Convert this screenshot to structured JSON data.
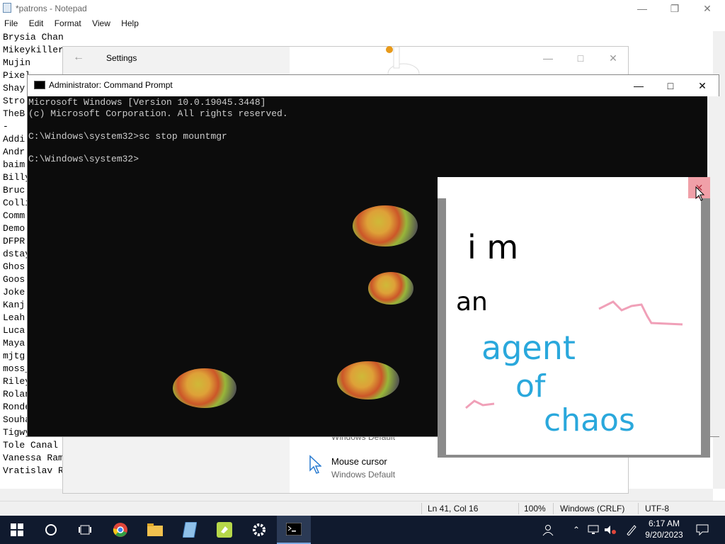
{
  "notepad": {
    "title": "*patrons - Notepad",
    "menu": [
      "File",
      "Edit",
      "Format",
      "View",
      "Help"
    ],
    "lines": [
      "Brysia Chan",
      "Mikeykiller",
      "Mujin",
      "Pixel",
      "Shay",
      "Stro",
      "TheB",
      "-",
      "Addi",
      "Andr",
      "baim",
      "Billy",
      "Bruc",
      "Colli",
      "Comm",
      "Demo",
      "DFPR",
      "dstay",
      "Ghos",
      "Goos",
      "Joke",
      "Kanj",
      "Leah",
      "Luca",
      "Maya",
      "mjtg",
      "moss_",
      "Riley",
      "Rolan",
      "Ronde",
      "Souha",
      "Tigwy",
      "Tole Canal",
      "Vanessa Ram",
      "Vratislav R"
    ],
    "status": {
      "position": "Ln 41, Col 16",
      "zoom": "100%",
      "eol": "Windows (CRLF)",
      "encoding": "UTF-8"
    }
  },
  "settings": {
    "title": "Settings",
    "items": [
      {
        "label": "Windows Default",
        "sub": ""
      },
      {
        "label": "Mouse cursor",
        "sub": "Windows Default"
      }
    ]
  },
  "cmd": {
    "title": "Administrator: Command Prompt",
    "lines": [
      "Microsoft Windows [Version 10.0.19045.3448]",
      "(c) Microsoft Corporation. All rights reserved.",
      "",
      "C:\\Windows\\system32>sc stop mountmgr",
      "",
      "C:\\Windows\\system32>"
    ]
  },
  "note": {
    "lines": [
      "i m",
      "an",
      "agent",
      "of",
      "chaos"
    ],
    "colors": {
      "black": "#000000",
      "blue": "#2aa8dc",
      "pink": "#f0a0b8"
    }
  },
  "taskbar": {
    "time": "6:17 AM",
    "date": "9/20/2023",
    "apps": [
      "start-icon",
      "cortana-icon",
      "task-view-icon",
      "chrome-icon",
      "file-explorer-icon",
      "notepad-app-icon",
      "goose-icon",
      "settings-gear-icon",
      "cmd-icon"
    ]
  }
}
